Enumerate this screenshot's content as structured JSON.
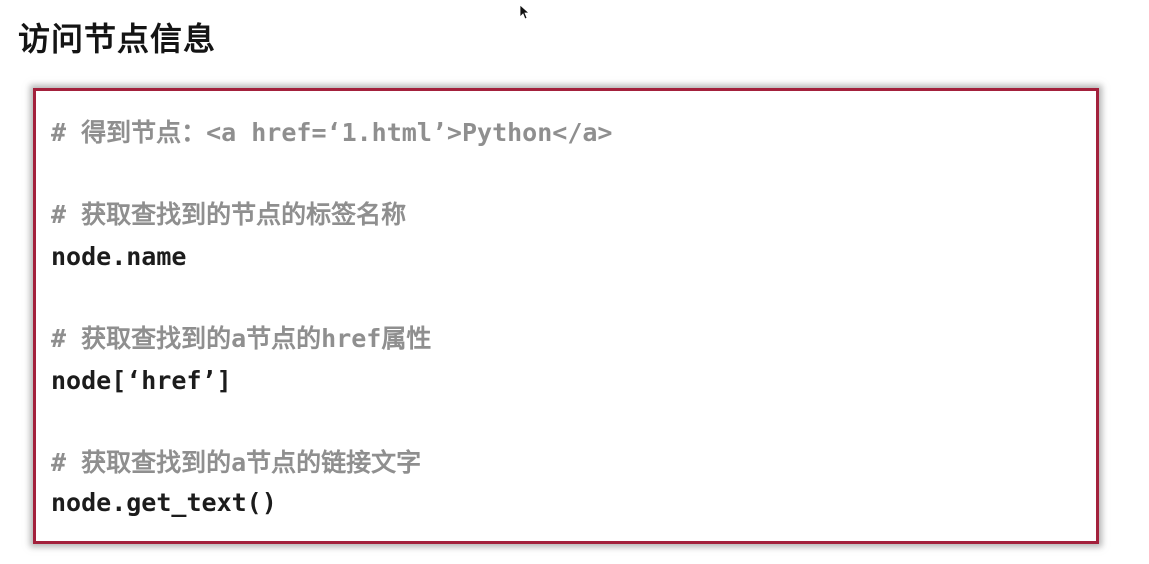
{
  "slide": {
    "title": "访问节点信息"
  },
  "code_block": {
    "lines": [
      {
        "kind": "comment",
        "text": "# 得到节点：<a href=‘1.html’>Python</a>"
      },
      {
        "kind": "comment",
        "text": "# 获取查找到的节点的标签名称"
      },
      {
        "kind": "code",
        "text": "node.name"
      },
      {
        "kind": "comment",
        "text": "# 获取查找到的a节点的href属性"
      },
      {
        "kind": "code",
        "text": "node[‘href’]"
      },
      {
        "kind": "comment",
        "text": "# 获取查找到的a节点的链接文字"
      },
      {
        "kind": "code",
        "text": "node.get_text()"
      }
    ]
  },
  "colors": {
    "border": "#a3213c",
    "comment": "#8f8f8f",
    "code": "#1c1c1c",
    "title": "#141414"
  },
  "icons": {
    "cursor": "mouse-pointer-icon"
  }
}
